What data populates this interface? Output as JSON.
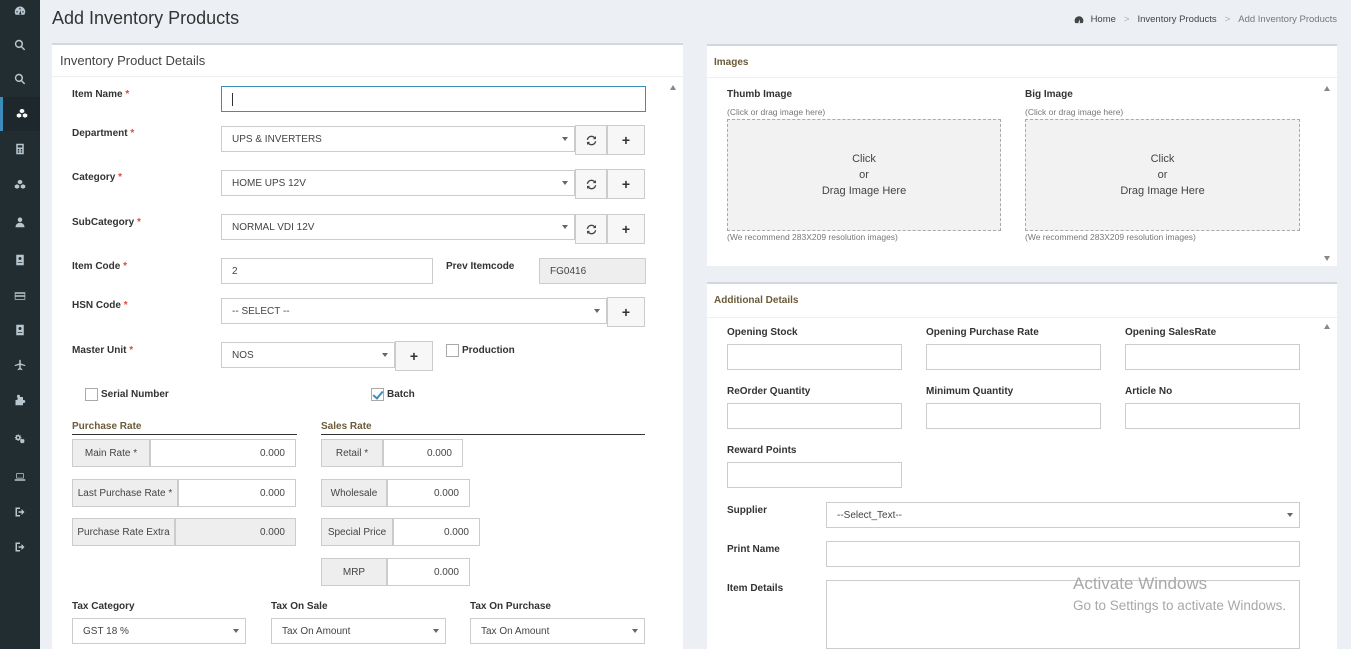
{
  "page": {
    "title": "Add Inventory Products"
  },
  "breadcrumb": {
    "home": "Home",
    "section": "Inventory Products",
    "current": "Add Inventory Products"
  },
  "sidebar": {
    "icons": [
      "dashboard-icon",
      "search-icon",
      "search-icon",
      "cubes-icon",
      "calculator-icon",
      "cubes-icon",
      "user-icon",
      "id-card-icon",
      "credit-card-icon",
      "id-card-icon",
      "plane-icon",
      "puzzle-icon",
      "gears-icon",
      "laptop-icon",
      "sign-out-icon",
      "sign-out-icon"
    ]
  },
  "details": {
    "title": "Inventory Product Details",
    "item_name": {
      "label": "Item Name",
      "value": ""
    },
    "department": {
      "label": "Department",
      "value": "UPS & INVERTERS"
    },
    "category": {
      "label": "Category",
      "value": "HOME UPS 12V"
    },
    "subcategory": {
      "label": "SubCategory",
      "value": "NORMAL VDI 12V"
    },
    "item_code": {
      "label": "Item Code",
      "value": "2"
    },
    "prev_itemcode": {
      "label": "Prev Itemcode",
      "value": "FG0416"
    },
    "hsn_code": {
      "label": "HSN Code",
      "value": "-- SELECT --"
    },
    "master_unit": {
      "label": "Master Unit",
      "value": "NOS"
    },
    "production": {
      "label": "Production",
      "checked": false
    },
    "serial_number": {
      "label": "Serial Number",
      "checked": false
    },
    "batch": {
      "label": "Batch",
      "checked": true
    },
    "purchase_rate": {
      "title": "Purchase Rate",
      "main_rate": {
        "label": "Main Rate *",
        "value": "0.000"
      },
      "last_purchase_rate": {
        "label": "Last Purchase Rate *",
        "value": "0.000"
      },
      "purchase_rate_extra": {
        "label": "Purchase Rate Extra",
        "value": "0.000"
      }
    },
    "sales_rate": {
      "title": "Sales Rate",
      "retail": {
        "label": "Retail *",
        "value": "0.000"
      },
      "wholesale": {
        "label": "Wholesale",
        "value": "0.000"
      },
      "special_price": {
        "label": "Special Price",
        "value": "0.000"
      },
      "mrp": {
        "label": "MRP",
        "value": "0.000"
      }
    },
    "tax_category": {
      "label": "Tax Category",
      "value": "GST 18 %"
    },
    "tax_on_sale": {
      "label": "Tax On Sale",
      "value": "Tax On Amount"
    },
    "tax_on_purchase": {
      "label": "Tax On Purchase",
      "value": "Tax On Amount"
    },
    "refresh_icon": "refresh-icon",
    "plus_label": "+"
  },
  "images": {
    "title": "Images",
    "thumb": {
      "label": "Thumb Image",
      "hint": "(Click or drag image here)",
      "drop_line1": "Click",
      "drop_line2": "or",
      "drop_line3": "Drag Image Here",
      "recommend": "(We recommend 283X209 resolution images)"
    },
    "big": {
      "label": "Big Image",
      "hint": "(Click or drag image here)",
      "drop_line1": "Click",
      "drop_line2": "or",
      "drop_line3": "Drag Image Here",
      "recommend": "(We recommend 283X209 resolution images)"
    }
  },
  "additional": {
    "title": "Additional Details",
    "opening_stock": "Opening Stock",
    "opening_purchase_rate": "Opening Purchase Rate",
    "opening_sales_rate": "Opening SalesRate",
    "reorder_quantity": "ReOrder Quantity",
    "minimum_quantity": "Minimum Quantity",
    "article_no": "Article No",
    "reward_points": "Reward Points",
    "supplier": {
      "label": "Supplier",
      "value": "--Select_Text--"
    },
    "print_name": "Print Name",
    "item_details": "Item Details"
  },
  "watermark": {
    "line1": "Activate Windows",
    "line2": "Go to Settings to activate Windows."
  }
}
